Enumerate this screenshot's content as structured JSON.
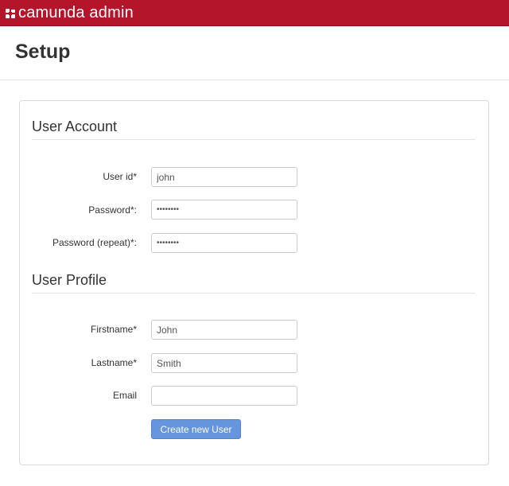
{
  "app": {
    "brand": "camunda admin",
    "brand_color": "#b5152b"
  },
  "page": {
    "title": "Setup"
  },
  "user_account": {
    "title": "User Account",
    "user_id": {
      "label": "User id*",
      "value": "john"
    },
    "password": {
      "label": "Password*:",
      "value": "••••••••"
    },
    "password_repeat": {
      "label": "Password (repeat)*:",
      "value": "••••••••"
    }
  },
  "user_profile": {
    "title": "User Profile",
    "firstname": {
      "label": "Firstname*",
      "value": "John"
    },
    "lastname": {
      "label": "Lastname*",
      "value": "Smith"
    },
    "email": {
      "label": "Email",
      "value": ""
    }
  },
  "actions": {
    "create_label": "Create new User",
    "button_color": "#6495dd"
  },
  "icons": {
    "brand": "camunda-logo-icon"
  }
}
